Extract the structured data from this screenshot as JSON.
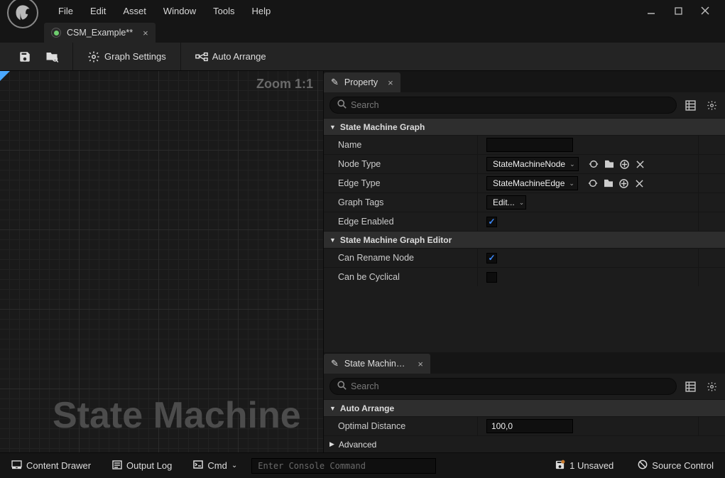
{
  "menu": {
    "items": [
      "File",
      "Edit",
      "Asset",
      "Window",
      "Tools",
      "Help"
    ]
  },
  "document_tab": {
    "title": "CSM_Example**"
  },
  "toolbar": {
    "save_icon": "save",
    "browse_icon": "browse",
    "graph_settings_label": "Graph Settings",
    "auto_arrange_label": "Auto Arrange"
  },
  "viewport": {
    "zoom_label": "Zoom 1:1",
    "watermark": "State Machine"
  },
  "property_panel": {
    "tab_label": "Property",
    "search_placeholder": "Search",
    "section1": {
      "title": "State Machine Graph",
      "rows": {
        "name": {
          "label": "Name",
          "value": ""
        },
        "node_type": {
          "label": "Node Type",
          "value": "StateMachineNode"
        },
        "edge_type": {
          "label": "Edge Type",
          "value": "StateMachineEdge"
        },
        "graph_tags": {
          "label": "Graph Tags",
          "value": "Edit..."
        },
        "edge_enabled": {
          "label": "Edge Enabled",
          "checked": true
        }
      }
    },
    "section2": {
      "title": "State Machine Graph Editor",
      "rows": {
        "can_rename": {
          "label": "Can Rename Node",
          "checked": true
        },
        "can_cyclical": {
          "label": "Can be Cyclical",
          "checked": false
        }
      }
    }
  },
  "editor_panel": {
    "tab_label": "State Machine E…",
    "search_placeholder": "Search",
    "section": {
      "title": "Auto Arrange",
      "rows": {
        "optimal_distance": {
          "label": "Optimal Distance",
          "value": "100,0"
        }
      }
    },
    "advanced_label": "Advanced"
  },
  "bottombar": {
    "content_drawer": "Content Drawer",
    "output_log": "Output Log",
    "cmd_label": "Cmd",
    "console_placeholder": "Enter Console Command",
    "unsaved": "1 Unsaved",
    "source_control": "Source Control"
  }
}
